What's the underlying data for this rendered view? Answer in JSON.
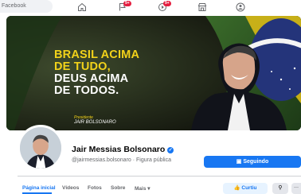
{
  "topbar": {
    "search_placeholder": "Facebook",
    "badges": {
      "flag": "9+",
      "video": "9+"
    },
    "icons": [
      "home-icon",
      "flag-icon",
      "video-icon",
      "marketplace-icon",
      "groups-icon"
    ]
  },
  "cover": {
    "line1": "BRASIL ACIMA",
    "line2": "DE TUDO,",
    "line3": "DEUS ACIMA",
    "line4": "DE TODOS.",
    "caption_role": "Presidente",
    "caption_name": "JAIR BOLSONARO",
    "colors": {
      "yellow": "#f2d21a",
      "green": "#2f5b24",
      "blue": "#23306b"
    }
  },
  "profile": {
    "name": "Jair Messias Bolsonaro",
    "handle_line": "@jairmessias.bolsonaro · Figura pública",
    "follow_label": "Seguindo"
  },
  "tabs": [
    {
      "label": "Página inicial",
      "active": true
    },
    {
      "label": "Vídeos"
    },
    {
      "label": "Fotos"
    },
    {
      "label": "Sobre"
    },
    {
      "label": "Mais"
    }
  ],
  "actions": {
    "like_label": "Curtiu",
    "search_icon": "search-icon",
    "more_label": "···"
  }
}
